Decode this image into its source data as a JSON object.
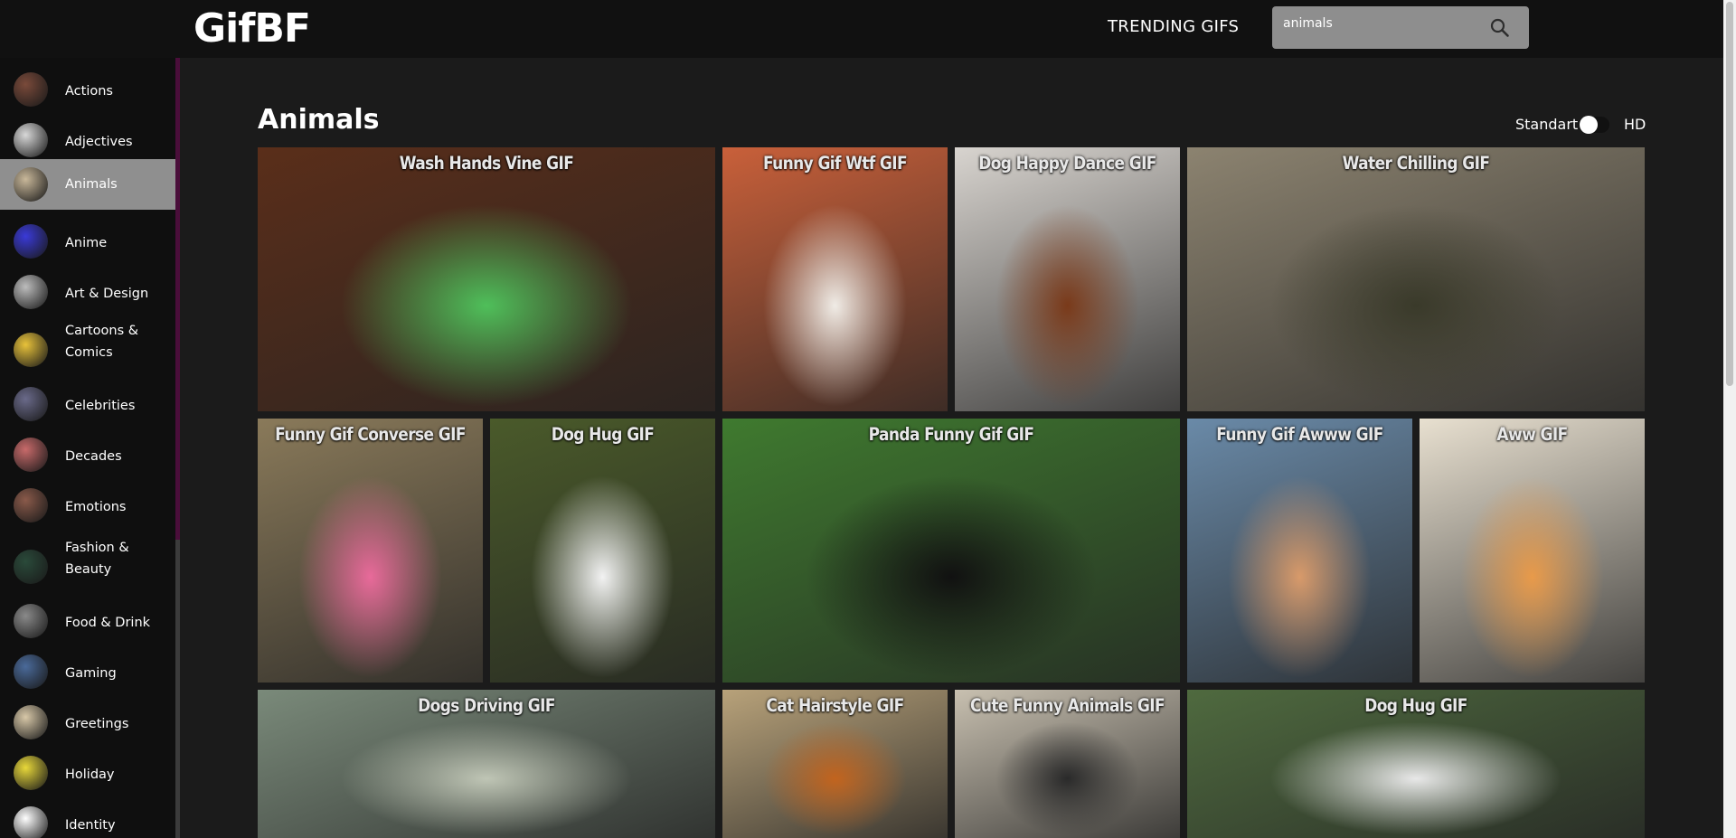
{
  "header": {
    "logo": "GifBF",
    "trending_label": "TRENDING GIFS",
    "search": {
      "value": "animals",
      "placeholder": ""
    }
  },
  "sidebar": {
    "items": [
      {
        "label": "Actions",
        "color": "#7a4a3a"
      },
      {
        "label": "Adjectives",
        "color": "#d8d8d8"
      },
      {
        "label": "Animals",
        "color": "#c9b89a",
        "active": true
      },
      {
        "label": "Anime",
        "color": "#3a3ad8"
      },
      {
        "label": "Art & Design",
        "color": "#bdbdbd"
      },
      {
        "label": "Cartoons & Comics",
        "color": "#e8c23a"
      },
      {
        "label": "Celebrities",
        "color": "#6a6a8a"
      },
      {
        "label": "Decades",
        "color": "#c86a6a"
      },
      {
        "label": "Emotions",
        "color": "#8a5a4a"
      },
      {
        "label": "Fashion & Beauty",
        "color": "#2a4a3a"
      },
      {
        "label": "Food & Drink",
        "color": "#8a8a8a"
      },
      {
        "label": "Gaming",
        "color": "#4a6a9a"
      },
      {
        "label": "Greetings",
        "color": "#d8c8a8"
      },
      {
        "label": "Holiday",
        "color": "#e8d83a"
      },
      {
        "label": "Identity",
        "color": "#ffffff"
      }
    ]
  },
  "main": {
    "title": "Animals",
    "quality": {
      "standard_label": "Standart",
      "hd_label": "HD"
    },
    "gifs": [
      {
        "title": "Wash Hands Vine GIF",
        "bg": "#5a2e1a",
        "accent": "#4fbf5a"
      },
      {
        "title": "Funny Gif Wtf GIF",
        "bg": "#c9603a",
        "accent": "#f0ece6"
      },
      {
        "title": "Dog Happy Dance GIF",
        "bg": "#d8d4cf",
        "accent": "#7a3a1a"
      },
      {
        "title": "Water Chilling GIF",
        "bg": "#8c8370",
        "accent": "#3a3a2a"
      },
      {
        "title": "Funny Gif Converse GIF",
        "bg": "#8a7a5a",
        "accent": "#e86a9a"
      },
      {
        "title": "Dog Hug GIF",
        "bg": "#4a5a2a",
        "accent": "#f2f2f2"
      },
      {
        "title": "Panda Funny Gif GIF",
        "bg": "#3f7a2f",
        "accent": "#111111"
      },
      {
        "title": "Funny Gif Awww GIF",
        "bg": "#6a8aa8",
        "accent": "#d89a6a"
      },
      {
        "title": "Aww GIF",
        "bg": "#e8e0d0",
        "accent": "#e89a4a"
      },
      {
        "title": "Dogs Driving GIF",
        "bg": "#7a8a7a",
        "accent": "#bfc5b5"
      },
      {
        "title": "Cat Hairstyle GIF",
        "bg": "#b8a27a",
        "accent": "#c2641e"
      },
      {
        "title": "Cute Funny Animals GIF",
        "bg": "#c8c0b0",
        "accent": "#2a2a2a"
      },
      {
        "title": "Dog Hug GIF",
        "bg": "#4f6a3f",
        "accent": "#e8e8e8"
      }
    ]
  }
}
